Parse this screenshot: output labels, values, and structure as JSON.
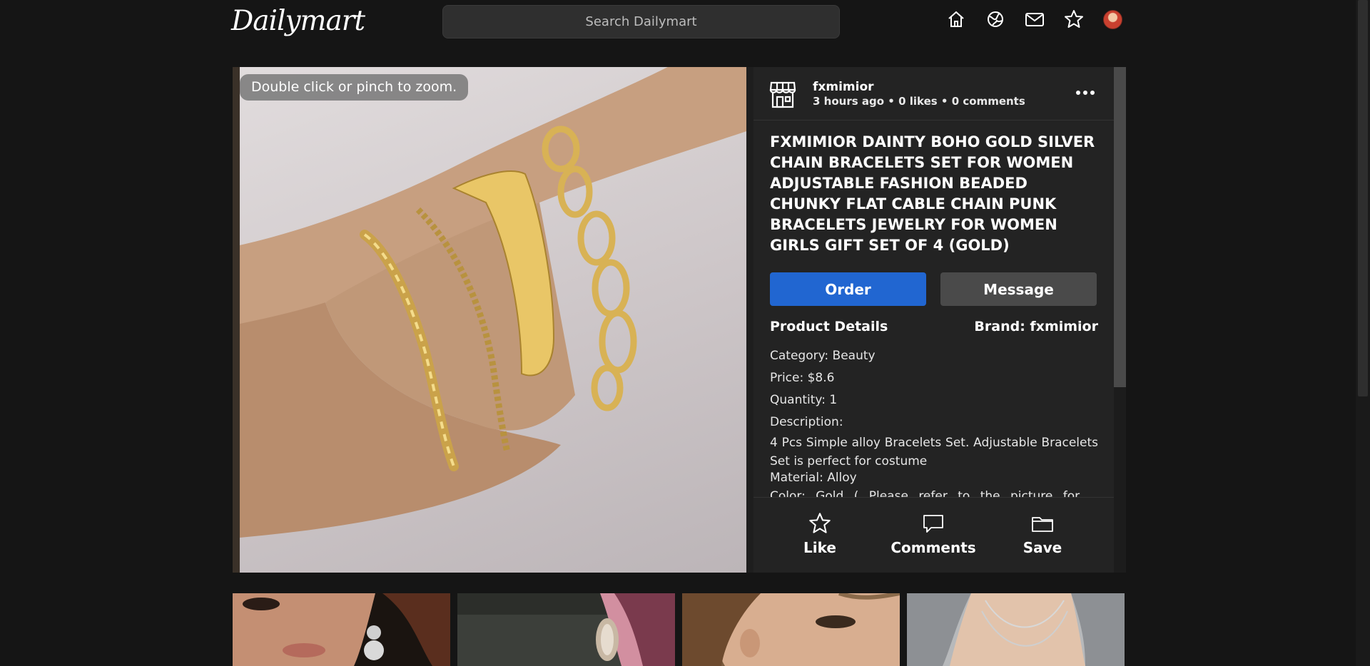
{
  "header": {
    "logo": "Dailymart",
    "search_placeholder": "Search Dailymart",
    "nav_icons": [
      "home-icon",
      "explore-icon",
      "mail-icon",
      "star-icon",
      "avatar"
    ]
  },
  "viewer": {
    "zoom_hint": "Double click or pinch to zoom."
  },
  "post": {
    "seller_name": "fxmimior",
    "meta": "3 hours ago • 0 likes • 0 comments",
    "title": "FXMIMIOR DAINTY BOHO GOLD SILVER CHAIN BRACELETS SET FOR WOMEN ADJUSTABLE FASHION BEADED CHUNKY FLAT CABLE CHAIN PUNK BRACELETS JEWELRY FOR WOMEN GIRLS GIFT SET OF 4 (GOLD)",
    "order_label": "Order",
    "message_label": "Message",
    "details_heading": "Product Details",
    "brand": "Brand: fxmimior",
    "category": "Category: Beauty",
    "price": "Price: $8.6",
    "quantity": "Quantity: 1",
    "description_label": "Description:",
    "description_text": "4 Pcs Simple alloy Bracelets Set. Adjustable Bracelets Set is perfect for costume",
    "material": "Material: Alloy",
    "color": "Color: Gold ( Please refer to the picture for"
  },
  "actions": {
    "like": "Like",
    "comments": "Comments",
    "save": "Save"
  },
  "colors": {
    "background": "#151515",
    "order_button": "#2166d1",
    "message_button": "#4a4a4a",
    "panel": "#232323"
  }
}
